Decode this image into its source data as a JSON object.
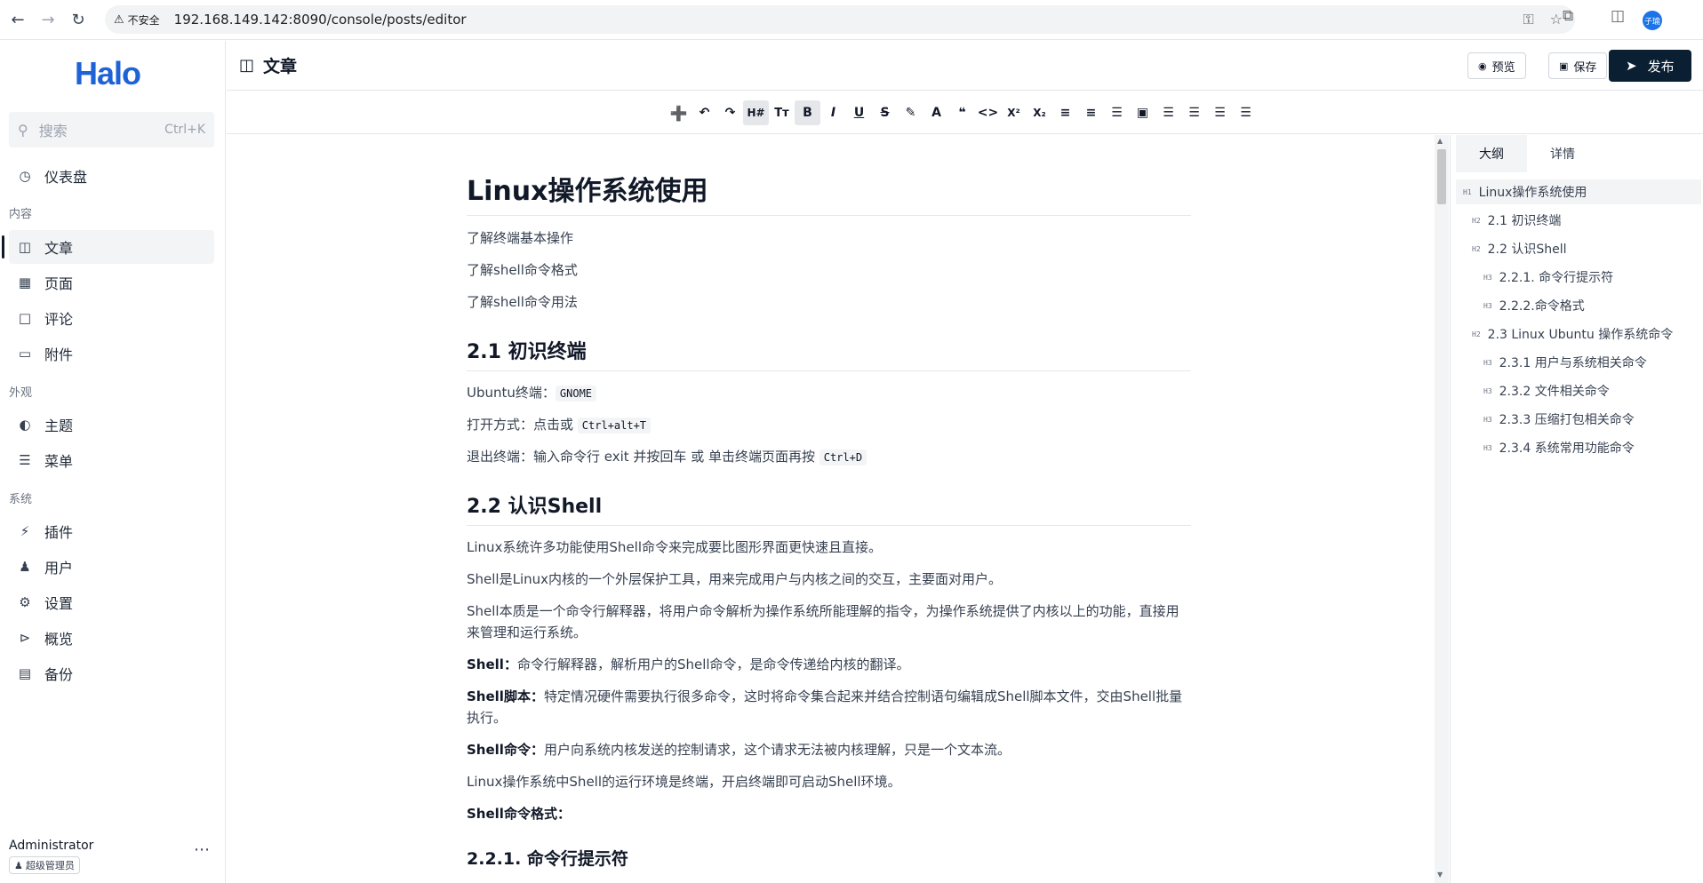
{
  "browser": {
    "security_label": "不安全",
    "url": "192.168.149.142:8090/console/posts/editor",
    "profile_initials": "子瑜"
  },
  "sidebar": {
    "logo": "Halo",
    "search": {
      "placeholder": "搜索",
      "shortcut": "Ctrl+K"
    },
    "dashboard": "仪表盘",
    "groups": {
      "content": "内容",
      "appearance": "外观",
      "system": "系统"
    },
    "items": {
      "posts": "文章",
      "pages": "页面",
      "comments": "评论",
      "attachments": "附件",
      "themes": "主题",
      "menus": "菜单",
      "plugins": "插件",
      "users": "用户",
      "settings": "设置",
      "overview": "概览",
      "backup": "备份"
    },
    "user": {
      "name": "Administrator",
      "role": "超级管理员"
    }
  },
  "header": {
    "title": "文章",
    "preview": "预览",
    "save": "保存",
    "publish": "发布"
  },
  "editor": {
    "h1": "Linux操作系统使用",
    "intro": [
      "了解终端基本操作",
      "了解shell命令格式",
      "了解shell命令用法"
    ],
    "s21": {
      "title": "2.1 初识终端",
      "terminal_label": "Ubuntu终端：",
      "terminal_code": "GNOME",
      "open_label": "打开方式：点击或 ",
      "open_code": "Ctrl+alt+T",
      "exit_label": "退出终端：输入命令行 exit 并按回车 或 单击终端页面再按 ",
      "exit_code": "Ctrl+D"
    },
    "s22": {
      "title": "2.2 认识Shell",
      "p1": "Linux系统许多功能使用Shell命令来完成要比图形界面更快速且直接。",
      "p2": "Shell是Linux内核的一个外层保护工具，用来完成用户与内核之间的交互，主要面对用户。",
      "p3": "Shell本质是一个命令行解释器，将用户命令解析为操作系统所能理解的指令，为操作系统提供了内核以上的功能，直接用来管理和运行系统。",
      "p4_bold": "Shell：",
      "p4": "命令行解释器，解析用户的Shell命令，是命令传递给内核的翻译。",
      "p5_bold": "Shell脚本：",
      "p5": "特定情况硬件需要执行很多命令，这时将命令集合起来并结合控制语句编辑成Shell脚本文件，交由Shell批量执行。",
      "p6_bold": "Shell命令：",
      "p6": "用户向系统内核发送的控制请求，这个请求无法被内核理解，只是一个文本流。",
      "p7": "Linux操作系统中Shell的运行环境是终端，开启终端即可启动Shell环境。",
      "p8_bold": "Shell命令格式："
    },
    "s221": {
      "title": "2.2.1. 命令行提示符"
    }
  },
  "panel": {
    "tabs": [
      "大纲",
      "详情"
    ],
    "outline": [
      {
        "level": "H1",
        "text": "Linux操作系统使用"
      },
      {
        "level": "H2",
        "text": "2.1 初识终端"
      },
      {
        "level": "H2",
        "text": "2.2 认识Shell"
      },
      {
        "level": "H3",
        "text": "2.2.1. 命令行提示符"
      },
      {
        "level": "H3",
        "text": "2.2.2.命令格式"
      },
      {
        "level": "H2",
        "text": "2.3 Linux Ubuntu 操作系统命令"
      },
      {
        "level": "H3",
        "text": "2.3.1 用户与系统相关命令"
      },
      {
        "level": "H3",
        "text": "2.3.2 文件相关命令"
      },
      {
        "level": "H3",
        "text": "2.3.3 压缩打包相关命令"
      },
      {
        "level": "H3",
        "text": "2.3.4 系统常用功能命令"
      }
    ]
  }
}
